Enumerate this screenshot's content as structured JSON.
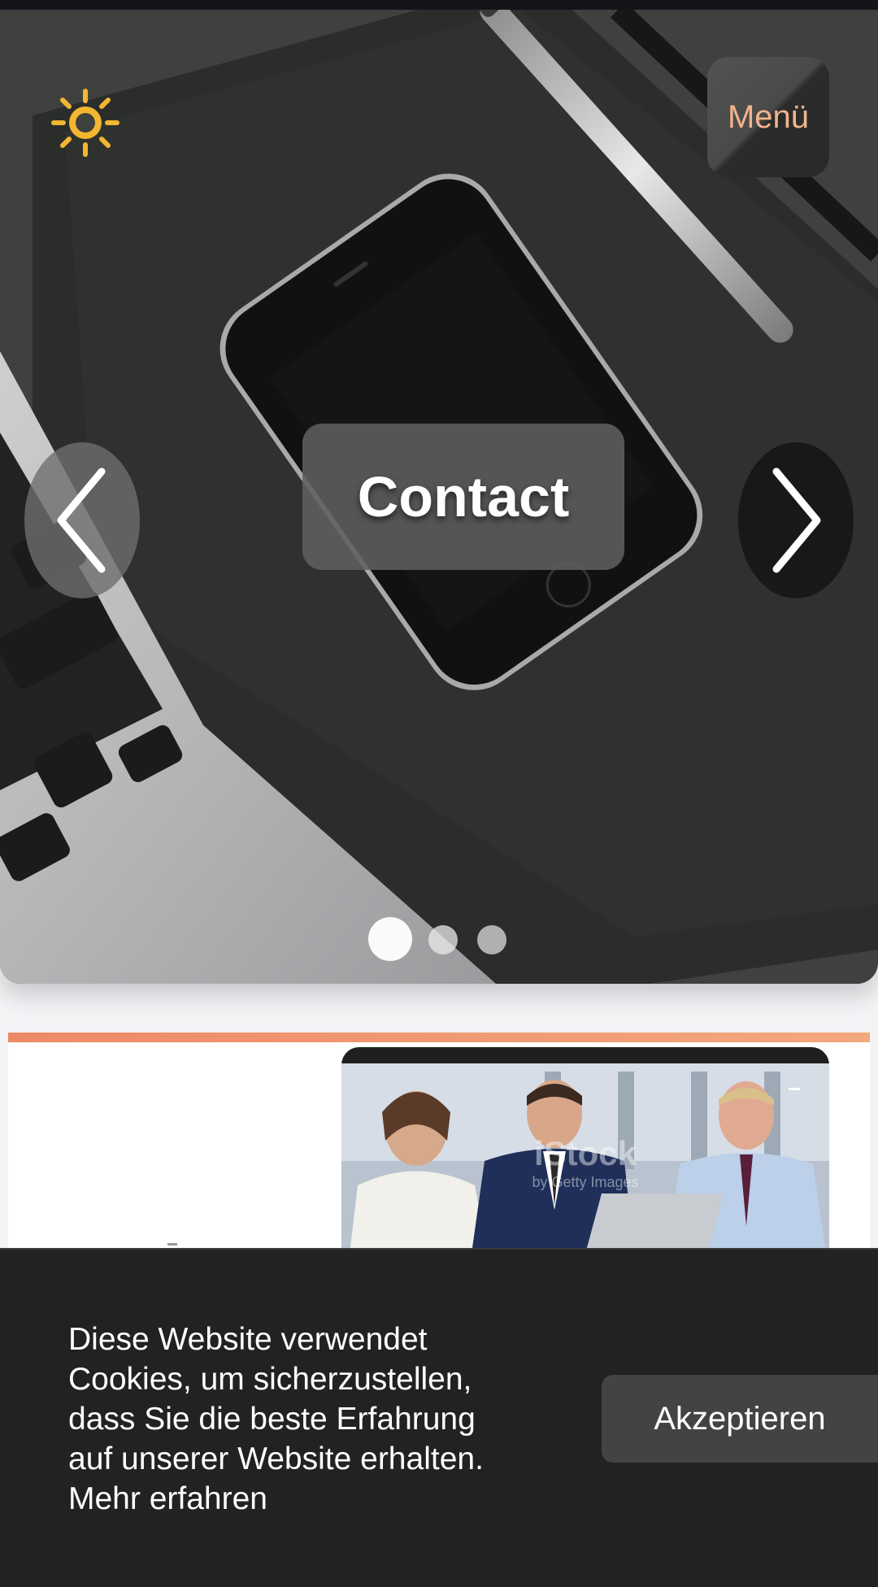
{
  "hero": {
    "menu_label": "Menü",
    "slide_title": "Contact",
    "active_slide": 1,
    "slide_count": 3,
    "theme_icon": "sun-icon",
    "prev_icon": "chevron-left-icon",
    "next_icon": "chevron-right-icon",
    "menu_text_color": "#f2b38c",
    "sun_color": "#f2b630"
  },
  "section": {
    "accent_color": "#ed8a66"
  },
  "cookie": {
    "message": "Diese Website verwendet Cookies, um sicherzustellen, dass Sie die beste Erfahrung auf unserer Website erhalten.",
    "more_link": "Mehr erfahren",
    "accept_label": "Akzeptieren"
  }
}
